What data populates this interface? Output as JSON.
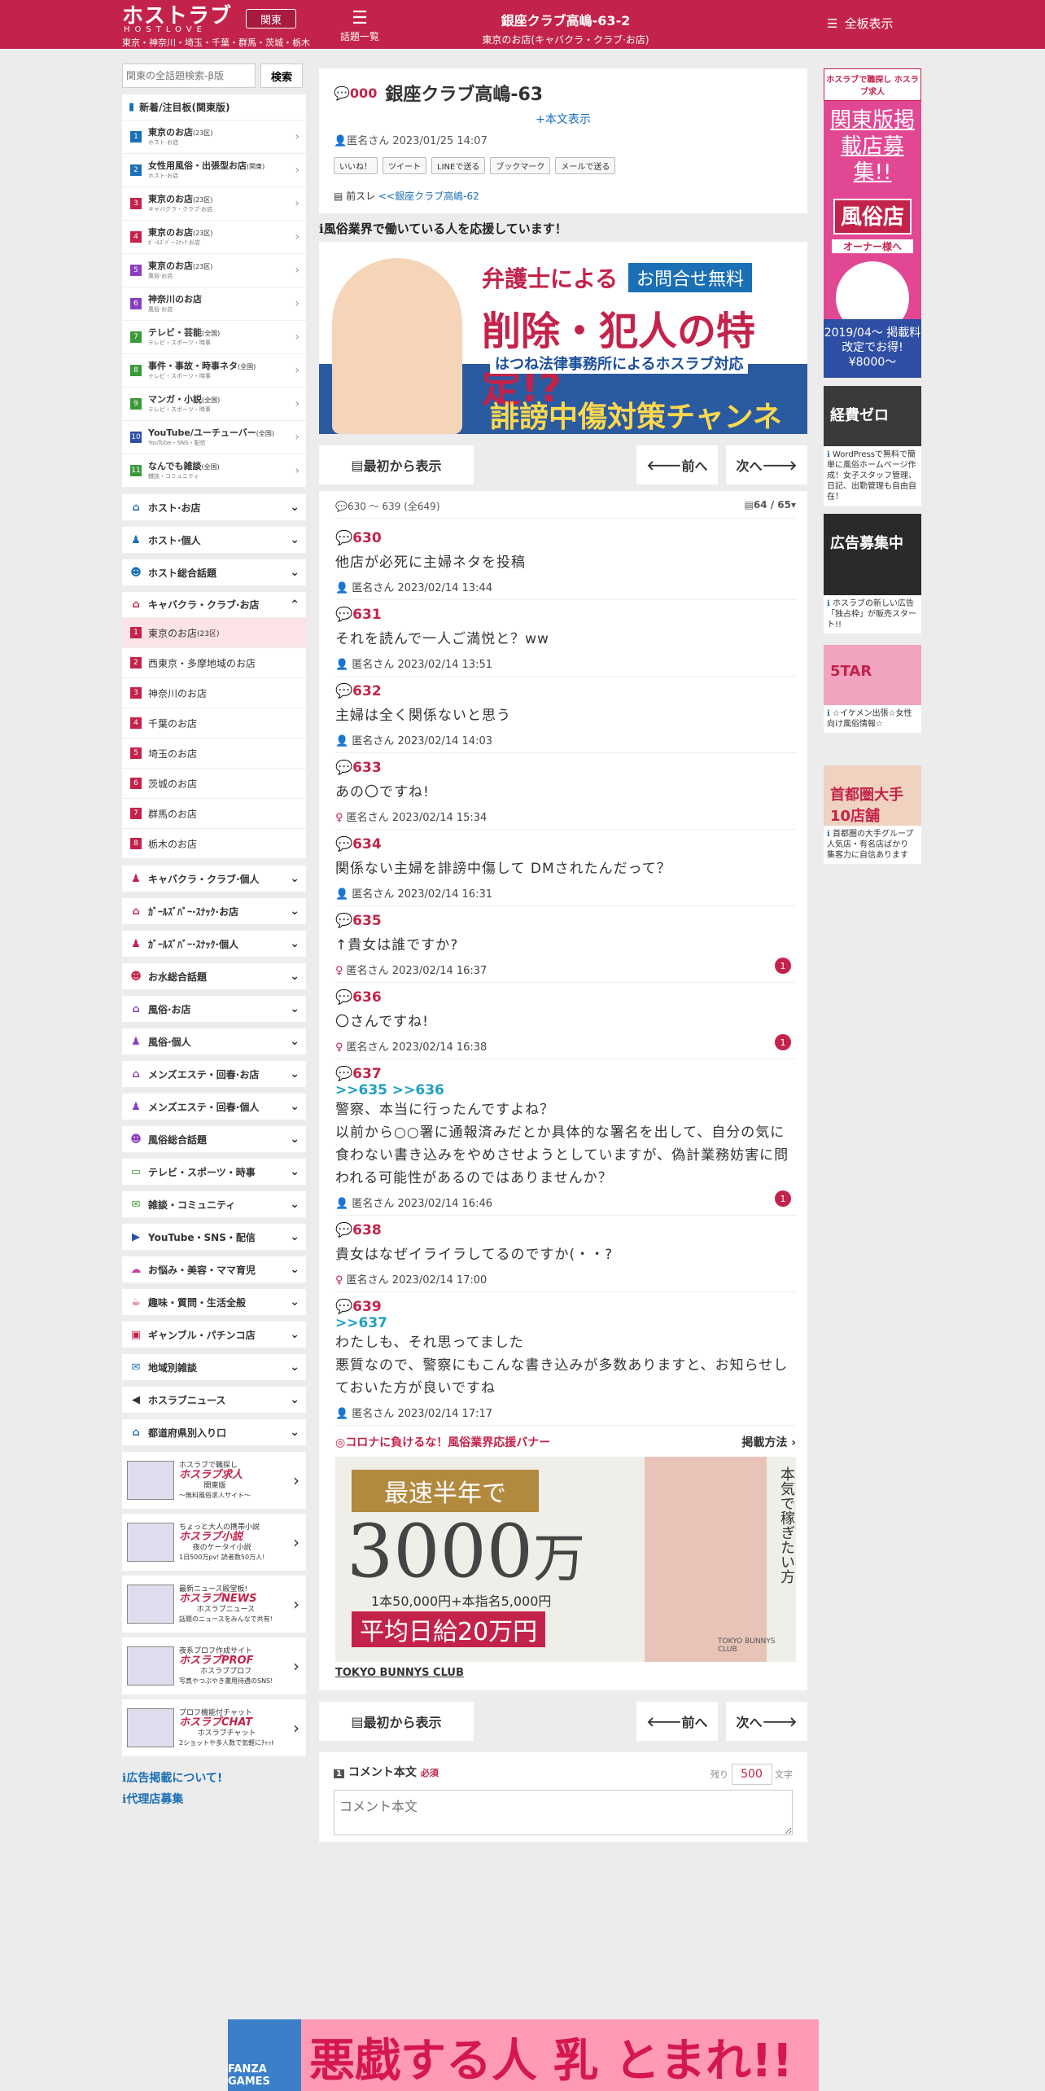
{
  "header": {
    "logo": "ホストラブ",
    "logo_sub": "HOSTLOVE",
    "region": "東京・神奈川・埼玉・千葉・群馬・茨城・栃木",
    "area_button": "関東",
    "topics_label": "話題一覧",
    "title": "銀座クラブ高嶋-63-2",
    "subtitle": "東京のお店(キャバクラ・クラブ·お店)",
    "all_label": "全板表示"
  },
  "sidebar": {
    "search_placeholder": "関東の全話題検索-β版",
    "search_button": "検索",
    "new_header": "新着/注目板(関東版)",
    "new_items": [
      {
        "num": "1",
        "label": "東京のお店",
        "tag": "(23区)",
        "sub": "ホスト·お店",
        "color": "#1a6fb5"
      },
      {
        "num": "2",
        "label": "女性用風俗・出張型お店",
        "tag": "(関東)",
        "sub": "ホスト·お店",
        "color": "#1a6fb5"
      },
      {
        "num": "3",
        "label": "東京のお店",
        "tag": "(23区)",
        "sub": "キャバクラ・クラブ·お店",
        "color": "#c3234a"
      },
      {
        "num": "4",
        "label": "東京のお店",
        "tag": "(23区)",
        "sub": "ｶﾞｰﾙｽﾞﾊﾞｰ·ｽﾅｯｸ·お店",
        "color": "#c3234a"
      },
      {
        "num": "5",
        "label": "東京のお店",
        "tag": "(23区)",
        "sub": "風俗·お店",
        "color": "#8a3fc0"
      },
      {
        "num": "6",
        "label": "神奈川のお店",
        "tag": "",
        "sub": "風俗·お店",
        "color": "#8a3fc0"
      },
      {
        "num": "7",
        "label": "テレビ・芸能",
        "tag": "(全国)",
        "sub": "テレビ・スポーツ・時事",
        "color": "#3a9a3a"
      },
      {
        "num": "8",
        "label": "事件・事故・時事ネタ",
        "tag": "(全国)",
        "sub": "テレビ・スポーツ・時事",
        "color": "#3a9a3a"
      },
      {
        "num": "9",
        "label": "マンガ・小説",
        "tag": "(全国)",
        "sub": "テレビ・スポーツ・時事",
        "color": "#3a9a3a"
      },
      {
        "num": "10",
        "label": "YouTube/ユーチューバー",
        "tag": "(全国)",
        "sub": "YouTube・SNS・配信",
        "color": "#2a4fa5"
      },
      {
        "num": "11",
        "label": "なんでも雑談",
        "tag": "(全国)",
        "sub": "雑談・コミュニティ",
        "color": "#3a9a3a"
      }
    ],
    "cats_top": [
      {
        "label": "ホスト·お店",
        "icon": "⌂",
        "color": "#1a6fb5"
      },
      {
        "label": "ホスト·個人",
        "icon": "♟",
        "color": "#1a6fb5"
      },
      {
        "label": "ホスト総合話題",
        "icon": "☻",
        "color": "#1a6fb5"
      }
    ],
    "open_cat": {
      "label": "キャバクラ・クラブ·お店",
      "icon": "⌂",
      "color": "#c3234a"
    },
    "sub_items": [
      {
        "num": "1",
        "label": "東京のお店",
        "tag": "(23区)"
      },
      {
        "num": "2",
        "label": "西東京・多摩地域のお店",
        "tag": ""
      },
      {
        "num": "3",
        "label": "神奈川のお店",
        "tag": ""
      },
      {
        "num": "4",
        "label": "千葉のお店",
        "tag": ""
      },
      {
        "num": "5",
        "label": "埼玉のお店",
        "tag": ""
      },
      {
        "num": "6",
        "label": "茨城のお店",
        "tag": ""
      },
      {
        "num": "7",
        "label": "群馬のお店",
        "tag": ""
      },
      {
        "num": "8",
        "label": "栃木のお店",
        "tag": ""
      }
    ],
    "cats_bottom": [
      {
        "label": "キャバクラ・クラブ·個人",
        "icon": "♟",
        "color": "#c3234a"
      },
      {
        "label": "ｶﾞｰﾙｽﾞﾊﾞｰ·ｽﾅｯｸ·お店",
        "icon": "⌂",
        "color": "#c3234a"
      },
      {
        "label": "ｶﾞｰﾙｽﾞﾊﾞｰ·ｽﾅｯｸ·個人",
        "icon": "♟",
        "color": "#c3234a"
      },
      {
        "label": "お水総合話題",
        "icon": "☻",
        "color": "#c3234a"
      },
      {
        "label": "風俗·お店",
        "icon": "⌂",
        "color": "#8a3fc0"
      },
      {
        "label": "風俗·個人",
        "icon": "♟",
        "color": "#8a3fc0"
      },
      {
        "label": "メンズエステ・回春·お店",
        "icon": "⌂",
        "color": "#8a3fc0"
      },
      {
        "label": "メンズエステ・回春·個人",
        "icon": "♟",
        "color": "#8a3fc0"
      },
      {
        "label": "風俗総合話題",
        "icon": "☻",
        "color": "#8a3fc0"
      },
      {
        "label": "テレビ・スポーツ・時事",
        "icon": "▭",
        "color": "#3a9a3a"
      },
      {
        "label": "雑談・コミュニティ",
        "icon": "✉",
        "color": "#3a9a3a"
      },
      {
        "label": "YouTube・SNS・配信",
        "icon": "▶",
        "color": "#2a4fa5"
      },
      {
        "label": "お悩み・美容・ママ育児",
        "icon": "☁",
        "color": "#c040a0"
      },
      {
        "label": "趣味・質問・生活全般",
        "icon": "☕",
        "color": "#c3234a"
      },
      {
        "label": "ギャンブル・パチンコ店",
        "icon": "▣",
        "color": "#c3234a"
      },
      {
        "label": "地域別雑談",
        "icon": "✉",
        "color": "#1a6fb5"
      },
      {
        "label": "ホスラブニュース",
        "icon": "◀",
        "color": "#333"
      },
      {
        "label": "都道府県別入り口",
        "icon": "⌂",
        "color": "#1a6fb5"
      }
    ],
    "promos": [
      {
        "title": "ホスラブ求人",
        "line1": "ホスラブで職探し",
        "line2": "関東版",
        "line3": "〜無料風俗求人サイト〜"
      },
      {
        "title": "ホスラブ小説",
        "line1": "ちょっと大人の携帯小説",
        "line2": "夜のケータイ小説",
        "line3": "1日500万pv! 読者数50万人!"
      },
      {
        "title": "ホスラブNEWS",
        "line1": "最新ニュース殿堂板!",
        "line2": "ホスラブニュース",
        "line3": "話題のニュースをみんなで共有!"
      },
      {
        "title": "ホスラブPROF",
        "line1": "夜系プロフ作成サイト",
        "line2": "ホスラブプロフ",
        "line3": "写真やつぶやき書用待遇のSNS!"
      },
      {
        "title": "ホスラブCHAT",
        "line1": "プロフ機能付チャット",
        "line2": "ホスラブチャット",
        "line3": "2ショットや多人数で気軽にﾁｬｯﾄ"
      }
    ],
    "links": [
      "広告掲載について!",
      "代理店募集"
    ]
  },
  "thread": {
    "post_num": "000",
    "title": "銀座クラブ高嶋-63",
    "show_body": "+本文表示",
    "author": "匿名さん 2023/01/25 14:07",
    "sns": [
      "いいね！",
      "ツイート",
      "LINEで送る",
      "ブックマーク",
      "メールで送る"
    ],
    "prev_label": "前スレ",
    "prev_link": "<<銀座クラブ高嶋-62"
  },
  "support_text": "風俗業界で働いている人を応援しています！",
  "banner1": {
    "line1": "弁護士による",
    "line1b": "お問合せ無料",
    "line2": "削除・犯人の特定!?",
    "line3": "はつね法律事務所によるホスラブ対応",
    "line4": "誹謗中傷対策チャンネル"
  },
  "nav": {
    "first": "最初から表示",
    "prev": "前へ",
    "next": "次へ"
  },
  "list": {
    "range": "630 〜 639",
    "total": "(全649)",
    "page": "64 / 65"
  },
  "posts": [
    {
      "num": "630",
      "anchor": "",
      "body": "他店が必死に主婦ネタを投稿",
      "meta": "匿名さん 2023/02/14 13:44",
      "badge": "",
      "female": false
    },
    {
      "num": "631",
      "anchor": "",
      "body": "それを読んで一人ご満悦と？ww",
      "meta": "匿名さん 2023/02/14 13:51",
      "badge": "",
      "female": false
    },
    {
      "num": "632",
      "anchor": "",
      "body": "主婦は全く関係ないと思う",
      "meta": "匿名さん 2023/02/14 14:03",
      "badge": "",
      "female": false
    },
    {
      "num": "633",
      "anchor": "",
      "body": "あの〇ですね!",
      "meta": "匿名さん 2023/02/14 15:34",
      "badge": "",
      "female": true
    },
    {
      "num": "634",
      "anchor": "",
      "body": "関係ない主婦を誹謗中傷して DMされたんだって？",
      "meta": "匿名さん 2023/02/14 16:31",
      "badge": "",
      "female": false
    },
    {
      "num": "635",
      "anchor": "",
      "body": "↑貴女は誰ですか?",
      "meta": "匿名さん 2023/02/14 16:37",
      "badge": "1",
      "female": true
    },
    {
      "num": "636",
      "anchor": "",
      "body": "〇さんですね!",
      "meta": "匿名さん 2023/02/14 16:38",
      "badge": "1",
      "female": true
    },
    {
      "num": "637",
      "anchor": ">>635 >>636",
      "body": "警察、本当に行ったんですよね？\n以前から○○署に通報済みだとか具体的な署名を出して、自分の気に食わない書き込みをやめさせようとしていますが、偽計業務妨害に問われる可能性があるのではありませんか？",
      "meta": "匿名さん 2023/02/14 16:46",
      "badge": "1",
      "female": false
    },
    {
      "num": "638",
      "anchor": "",
      "body": "貴女はなぜイライラしてるのですか(・・?",
      "meta": "匿名さん 2023/02/14 17:00",
      "badge": "",
      "female": true
    },
    {
      "num": "639",
      "anchor": ">>637",
      "body": "わたしも、それ思ってました\n悪質なので、警察にもこんな書き込みが多数ありますと、お知らせしておいた方が良いですね",
      "meta": "匿名さん 2023/02/14 17:17",
      "badge": "",
      "female": false
    }
  ],
  "corona": {
    "title": "◎コロナに負けるな！風俗業界応援バナー",
    "method": "掲載方法"
  },
  "banner2": {
    "line1": "最速半年で",
    "big": "3000",
    "big_unit": "万",
    "line2": "1本50,000円+本指名5,000円",
    "line3": "平均日給20万円",
    "vertical": "本気で稼ぎたい方",
    "brand": "TOKYO BUNNYS CLUB",
    "caption": "TOKYO BUNNYS CLUB"
  },
  "comment": {
    "title": "コメント本文",
    "required": "必須",
    "remaining_label": "残り",
    "remaining": "500",
    "unit": "文字",
    "placeholder": "コメント本文"
  },
  "right_ads": {
    "ad1": {
      "top": "ホスラブで職探し ホスラブ求人",
      "main": "関東版掲載店募集!!",
      "tag": "風俗店",
      "owner": "オーナー様へ",
      "bottom": "2019/04〜 掲載料改定でお得!¥8000〜"
    },
    "small": [
      {
        "title": "経費ゼロ",
        "cap": "WordPressで無料で簡単に風俗ホームページ作成！女子スタッフ管理、日記、出勤管理も自由自在！"
      },
      {
        "title": "広告募集中",
        "cap": "ホスラブの新しい広告「独占枠」が販売スタート!!"
      },
      {
        "title": "5TAR",
        "cap": "☆イケメン出張☆女性向け風俗情報☆"
      },
      {
        "title": "首都圏大手10店舗",
        "cap": "首都圏の大手グループ 人気店・有名店ばかり 集客力に自信あります"
      }
    ]
  },
  "footer_banner": {
    "brand": "FANZA GAMES",
    "text": "悪戯する人 乳 とまれ!!"
  }
}
